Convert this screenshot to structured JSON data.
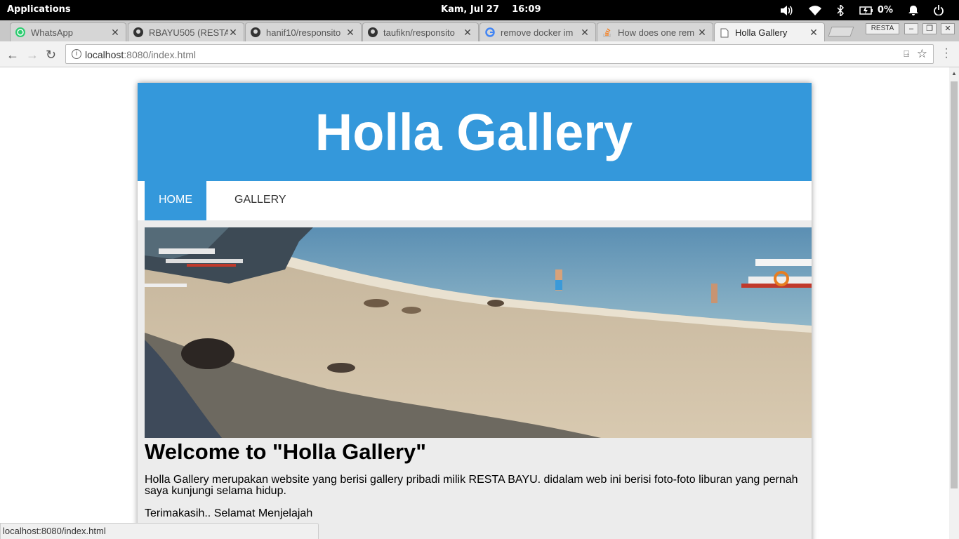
{
  "system": {
    "apps_label": "Applications",
    "clock": "Kam, Jul 27    16:09",
    "battery": "0%"
  },
  "tabs": [
    {
      "title": "WhatsApp",
      "icon": "whatsapp-icon"
    },
    {
      "title": "RBAYU505 (RESTA",
      "icon": "github-icon"
    },
    {
      "title": "hanif10/responsito",
      "icon": "github-icon"
    },
    {
      "title": "taufikn/responsito",
      "icon": "github-icon"
    },
    {
      "title": "remove docker im",
      "icon": "google-icon"
    },
    {
      "title": "How does one rem",
      "icon": "stackoverflow-icon"
    },
    {
      "title": "Holla Gallery",
      "icon": "page-icon"
    }
  ],
  "window": {
    "profile": "RESTA"
  },
  "address": {
    "host": "localhost",
    "rest": ":8080/index.html"
  },
  "site": {
    "title": "Holla Gallery",
    "nav": {
      "home": "HOME",
      "gallery": "GALLERY"
    },
    "welcome": "Welcome to \"Holla Gallery\"",
    "description": "Holla Gallery merupakan website yang berisi gallery pribadi milik RESTA BAYU. didalam web ini berisi foto-foto liburan yang pernah saya kunjungi selama hidup.",
    "thanks": "Terimakasih.. Selamat Menjelajah"
  },
  "status": {
    "text": "localhost:8080/index.html"
  },
  "colors": {
    "brand": "#3498db"
  }
}
